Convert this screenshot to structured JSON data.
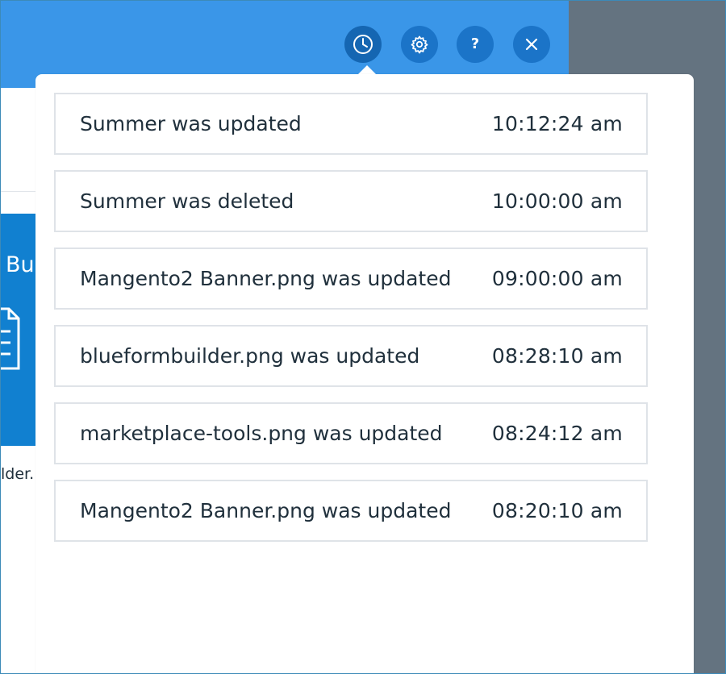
{
  "header": {
    "toolbar": [
      {
        "name": "history",
        "icon": "clock-icon"
      },
      {
        "name": "settings",
        "icon": "gear-icon"
      },
      {
        "name": "help",
        "icon": "question-icon",
        "label": "?"
      },
      {
        "name": "close",
        "icon": "close-icon"
      }
    ]
  },
  "background": {
    "card_text": "Bu",
    "caption": "lder."
  },
  "activity": [
    {
      "message": "Summer was updated",
      "time": "10:12:24 am"
    },
    {
      "message": "Summer was deleted",
      "time": "10:00:00 am"
    },
    {
      "message": "Mangento2 Banner.png was updated",
      "time": "09:00:00 am"
    },
    {
      "message": "blueformbuilder.png was updated",
      "time": "08:28:10 am"
    },
    {
      "message": "marketplace-tools.png was updated",
      "time": "08:24:12 am"
    },
    {
      "message": "Mangento2 Banner.png was updated",
      "time": "08:20:10 am"
    }
  ],
  "colors": {
    "header_blue": "#3a96e8",
    "icon_button": "#1b74c8",
    "side_gray": "#647380",
    "row_border": "#dfe3e8",
    "text": "#20303c"
  }
}
